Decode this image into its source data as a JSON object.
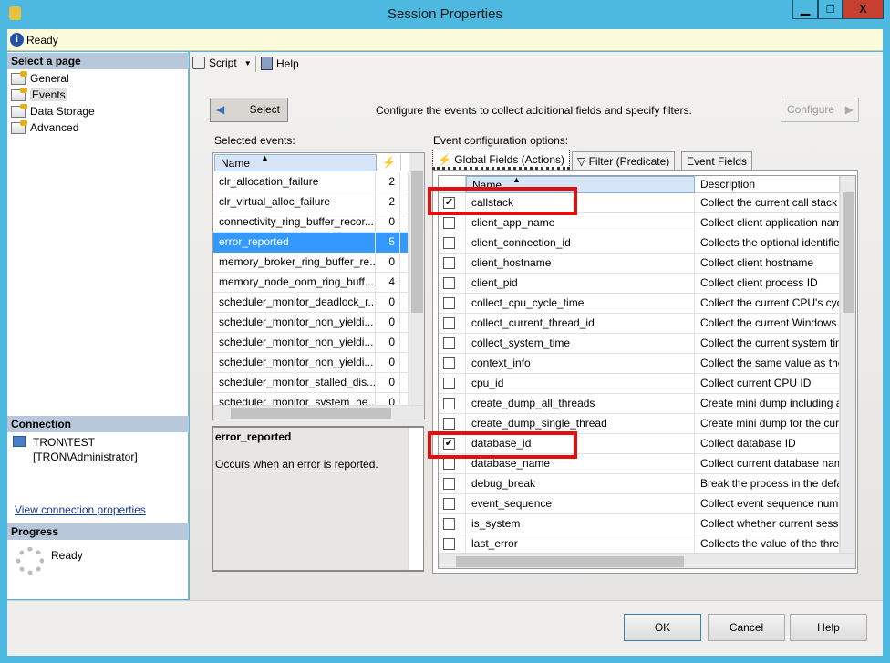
{
  "window": {
    "title": "Session Properties",
    "min": "▁",
    "max": "□",
    "close": "X"
  },
  "info": {
    "status": "Ready"
  },
  "sidebar": {
    "header": "Select a page",
    "items": [
      {
        "label": "General"
      },
      {
        "label": "Events"
      },
      {
        "label": "Data Storage"
      },
      {
        "label": "Advanced"
      }
    ],
    "connection_header": "Connection",
    "server": "TRON\\TEST",
    "user": "[TRON\\Administrator]",
    "view_link": "View connection properties",
    "progress_header": "Progress",
    "progress_status": "Ready"
  },
  "toolbar": {
    "script": "Script",
    "help": "Help"
  },
  "main": {
    "select_button": "Select",
    "instructions": "Configure the events to collect additional fields and specify filters.",
    "configure_button": "Configure",
    "selected_label": "Selected events:",
    "name_header": "Name",
    "events": [
      {
        "name": "clr_allocation_failure",
        "count": "2"
      },
      {
        "name": "clr_virtual_alloc_failure",
        "count": "2"
      },
      {
        "name": "connectivity_ring_buffer_recor...",
        "count": "0"
      },
      {
        "name": "error_reported",
        "count": "5",
        "selected": true
      },
      {
        "name": "memory_broker_ring_buffer_re...",
        "count": "0"
      },
      {
        "name": "memory_node_oom_ring_buff...",
        "count": "4"
      },
      {
        "name": "scheduler_monitor_deadlock_r...",
        "count": "0"
      },
      {
        "name": "scheduler_monitor_non_yieldi...",
        "count": "0"
      },
      {
        "name": "scheduler_monitor_non_yieldi...",
        "count": "0"
      },
      {
        "name": "scheduler_monitor_non_yieldi...",
        "count": "0"
      },
      {
        "name": "scheduler_monitor_stalled_dis...",
        "count": "0"
      },
      {
        "name": "scheduler_monitor_system_he...",
        "count": "0"
      }
    ],
    "detail_title": "error_reported",
    "detail_text": "Occurs when an error is reported.",
    "config_label": "Event configuration options:",
    "tabs": [
      {
        "label": "Global Fields (Actions)"
      },
      {
        "label": "Filter (Predicate)"
      },
      {
        "label": "Event Fields"
      }
    ],
    "fields_name_header": "Name",
    "fields_desc_header": "Description",
    "fields": [
      {
        "name": "callstack",
        "desc": "Collect the current call stack",
        "checked": true
      },
      {
        "name": "client_app_name",
        "desc": "Collect client application nam",
        "checked": false
      },
      {
        "name": "client_connection_id",
        "desc": "Collects the optional identifie",
        "checked": false
      },
      {
        "name": "client_hostname",
        "desc": "Collect client hostname",
        "checked": false
      },
      {
        "name": "client_pid",
        "desc": "Collect client process ID",
        "checked": false
      },
      {
        "name": "collect_cpu_cycle_time",
        "desc": "Collect the current CPU's cyc",
        "checked": false
      },
      {
        "name": "collect_current_thread_id",
        "desc": "Collect the current Windows t",
        "checked": false
      },
      {
        "name": "collect_system_time",
        "desc": "Collect the current system tin",
        "checked": false
      },
      {
        "name": "context_info",
        "desc": "Collect the same value as the",
        "checked": false
      },
      {
        "name": "cpu_id",
        "desc": "Collect current CPU ID",
        "checked": false
      },
      {
        "name": "create_dump_all_threads",
        "desc": "Create mini dump including a",
        "checked": false
      },
      {
        "name": "create_dump_single_thread",
        "desc": "Create mini dump for the cur",
        "checked": false
      },
      {
        "name": "database_id",
        "desc": "Collect database ID",
        "checked": true
      },
      {
        "name": "database_name",
        "desc": "Collect current database nam",
        "checked": false
      },
      {
        "name": "debug_break",
        "desc": "Break the process in the defau",
        "checked": false
      },
      {
        "name": "event_sequence",
        "desc": "Collect event sequence numb",
        "checked": false
      },
      {
        "name": "is_system",
        "desc": "Collect whether current sessio",
        "checked": false
      },
      {
        "name": "last_error",
        "desc": "Collects the value of the threa",
        "checked": false
      }
    ]
  },
  "footer": {
    "ok": "OK",
    "cancel": "Cancel",
    "help": "Help"
  }
}
